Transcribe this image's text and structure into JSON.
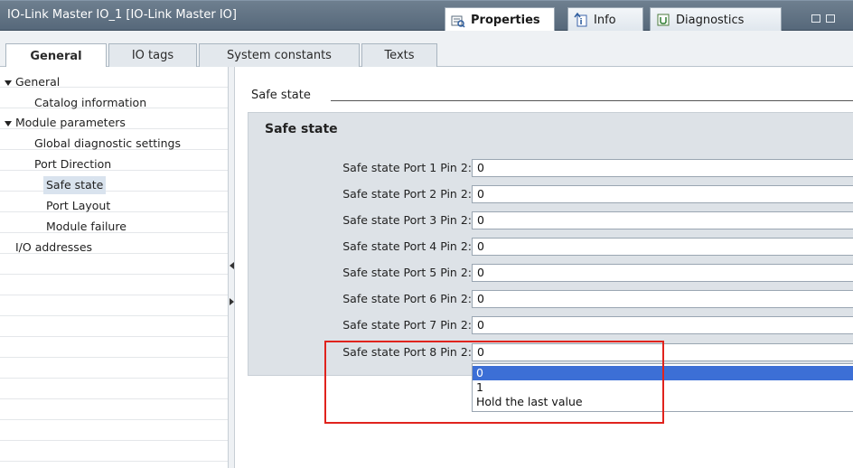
{
  "window": {
    "title": "IO-Link Master IO_1 [IO-Link Master IO]",
    "tabs": [
      {
        "label": "Properties",
        "icon": "properties-icon",
        "active": true
      },
      {
        "label": "Info",
        "icon": "info-icon",
        "active": false
      },
      {
        "label": "Diagnostics",
        "icon": "diagnostics-icon",
        "active": false
      }
    ]
  },
  "inspector_tabs": [
    {
      "label": "General",
      "active": true
    },
    {
      "label": "IO tags",
      "active": false
    },
    {
      "label": "System constants",
      "active": false
    },
    {
      "label": "Texts",
      "active": false
    }
  ],
  "tree": [
    {
      "label": "General",
      "expanded": true,
      "selected": false
    },
    {
      "label": "Catalog information",
      "selected": false
    },
    {
      "label": "Module parameters",
      "expanded": true,
      "selected": false
    },
    {
      "label": "Global diagnostic settings",
      "selected": false
    },
    {
      "label": "Port Direction",
      "selected": false
    },
    {
      "label": "Safe state",
      "selected": true
    },
    {
      "label": "Port Layout",
      "selected": false
    },
    {
      "label": "Module failure",
      "selected": false
    },
    {
      "label": "I/O addresses",
      "selected": false
    }
  ],
  "content": {
    "section_header": "Safe state",
    "panel_title": "Safe state",
    "fields": [
      {
        "label": "Safe state Port 1 Pin 2:",
        "value": "0"
      },
      {
        "label": "Safe state Port 2 Pin 2:",
        "value": "0"
      },
      {
        "label": "Safe state Port 3 Pin 2:",
        "value": "0"
      },
      {
        "label": "Safe state Port 4 Pin 2:",
        "value": "0"
      },
      {
        "label": "Safe state Port 5 Pin 2:",
        "value": "0"
      },
      {
        "label": "Safe state Port 6 Pin 2:",
        "value": "0"
      },
      {
        "label": "Safe state Port 7 Pin 2:",
        "value": "0"
      },
      {
        "label": "Safe state Port 8 Pin 2:",
        "value": "0"
      }
    ],
    "dropdown_options": [
      "0",
      "1",
      "Hold the last value"
    ],
    "highlighted_option": "0"
  },
  "colors": {
    "titlebar": "#5f7183",
    "panel": "#dde2e7",
    "selection": "#3c6fd6",
    "highlight_box": "#e0231d"
  }
}
